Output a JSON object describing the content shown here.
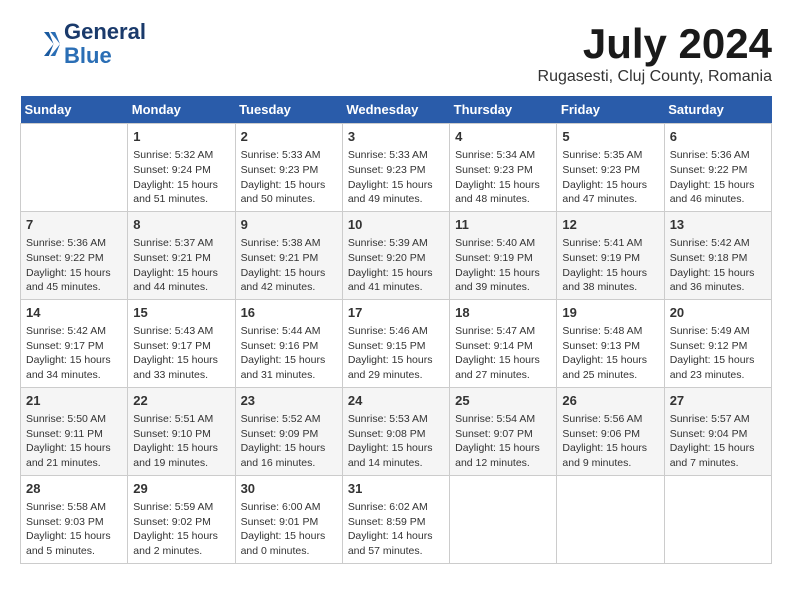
{
  "header": {
    "logo_line1": "General",
    "logo_line2": "Blue",
    "month_title": "July 2024",
    "location": "Rugasesti, Cluj County, Romania"
  },
  "weekdays": [
    "Sunday",
    "Monday",
    "Tuesday",
    "Wednesday",
    "Thursday",
    "Friday",
    "Saturday"
  ],
  "weeks": [
    [
      {
        "day": "",
        "info": ""
      },
      {
        "day": "1",
        "info": "Sunrise: 5:32 AM\nSunset: 9:24 PM\nDaylight: 15 hours\nand 51 minutes."
      },
      {
        "day": "2",
        "info": "Sunrise: 5:33 AM\nSunset: 9:23 PM\nDaylight: 15 hours\nand 50 minutes."
      },
      {
        "day": "3",
        "info": "Sunrise: 5:33 AM\nSunset: 9:23 PM\nDaylight: 15 hours\nand 49 minutes."
      },
      {
        "day": "4",
        "info": "Sunrise: 5:34 AM\nSunset: 9:23 PM\nDaylight: 15 hours\nand 48 minutes."
      },
      {
        "day": "5",
        "info": "Sunrise: 5:35 AM\nSunset: 9:23 PM\nDaylight: 15 hours\nand 47 minutes."
      },
      {
        "day": "6",
        "info": "Sunrise: 5:36 AM\nSunset: 9:22 PM\nDaylight: 15 hours\nand 46 minutes."
      }
    ],
    [
      {
        "day": "7",
        "info": "Sunrise: 5:36 AM\nSunset: 9:22 PM\nDaylight: 15 hours\nand 45 minutes."
      },
      {
        "day": "8",
        "info": "Sunrise: 5:37 AM\nSunset: 9:21 PM\nDaylight: 15 hours\nand 44 minutes."
      },
      {
        "day": "9",
        "info": "Sunrise: 5:38 AM\nSunset: 9:21 PM\nDaylight: 15 hours\nand 42 minutes."
      },
      {
        "day": "10",
        "info": "Sunrise: 5:39 AM\nSunset: 9:20 PM\nDaylight: 15 hours\nand 41 minutes."
      },
      {
        "day": "11",
        "info": "Sunrise: 5:40 AM\nSunset: 9:19 PM\nDaylight: 15 hours\nand 39 minutes."
      },
      {
        "day": "12",
        "info": "Sunrise: 5:41 AM\nSunset: 9:19 PM\nDaylight: 15 hours\nand 38 minutes."
      },
      {
        "day": "13",
        "info": "Sunrise: 5:42 AM\nSunset: 9:18 PM\nDaylight: 15 hours\nand 36 minutes."
      }
    ],
    [
      {
        "day": "14",
        "info": "Sunrise: 5:42 AM\nSunset: 9:17 PM\nDaylight: 15 hours\nand 34 minutes."
      },
      {
        "day": "15",
        "info": "Sunrise: 5:43 AM\nSunset: 9:17 PM\nDaylight: 15 hours\nand 33 minutes."
      },
      {
        "day": "16",
        "info": "Sunrise: 5:44 AM\nSunset: 9:16 PM\nDaylight: 15 hours\nand 31 minutes."
      },
      {
        "day": "17",
        "info": "Sunrise: 5:46 AM\nSunset: 9:15 PM\nDaylight: 15 hours\nand 29 minutes."
      },
      {
        "day": "18",
        "info": "Sunrise: 5:47 AM\nSunset: 9:14 PM\nDaylight: 15 hours\nand 27 minutes."
      },
      {
        "day": "19",
        "info": "Sunrise: 5:48 AM\nSunset: 9:13 PM\nDaylight: 15 hours\nand 25 minutes."
      },
      {
        "day": "20",
        "info": "Sunrise: 5:49 AM\nSunset: 9:12 PM\nDaylight: 15 hours\nand 23 minutes."
      }
    ],
    [
      {
        "day": "21",
        "info": "Sunrise: 5:50 AM\nSunset: 9:11 PM\nDaylight: 15 hours\nand 21 minutes."
      },
      {
        "day": "22",
        "info": "Sunrise: 5:51 AM\nSunset: 9:10 PM\nDaylight: 15 hours\nand 19 minutes."
      },
      {
        "day": "23",
        "info": "Sunrise: 5:52 AM\nSunset: 9:09 PM\nDaylight: 15 hours\nand 16 minutes."
      },
      {
        "day": "24",
        "info": "Sunrise: 5:53 AM\nSunset: 9:08 PM\nDaylight: 15 hours\nand 14 minutes."
      },
      {
        "day": "25",
        "info": "Sunrise: 5:54 AM\nSunset: 9:07 PM\nDaylight: 15 hours\nand 12 minutes."
      },
      {
        "day": "26",
        "info": "Sunrise: 5:56 AM\nSunset: 9:06 PM\nDaylight: 15 hours\nand 9 minutes."
      },
      {
        "day": "27",
        "info": "Sunrise: 5:57 AM\nSunset: 9:04 PM\nDaylight: 15 hours\nand 7 minutes."
      }
    ],
    [
      {
        "day": "28",
        "info": "Sunrise: 5:58 AM\nSunset: 9:03 PM\nDaylight: 15 hours\nand 5 minutes."
      },
      {
        "day": "29",
        "info": "Sunrise: 5:59 AM\nSunset: 9:02 PM\nDaylight: 15 hours\nand 2 minutes."
      },
      {
        "day": "30",
        "info": "Sunrise: 6:00 AM\nSunset: 9:01 PM\nDaylight: 15 hours\nand 0 minutes."
      },
      {
        "day": "31",
        "info": "Sunrise: 6:02 AM\nSunset: 8:59 PM\nDaylight: 14 hours\nand 57 minutes."
      },
      {
        "day": "",
        "info": ""
      },
      {
        "day": "",
        "info": ""
      },
      {
        "day": "",
        "info": ""
      }
    ]
  ]
}
